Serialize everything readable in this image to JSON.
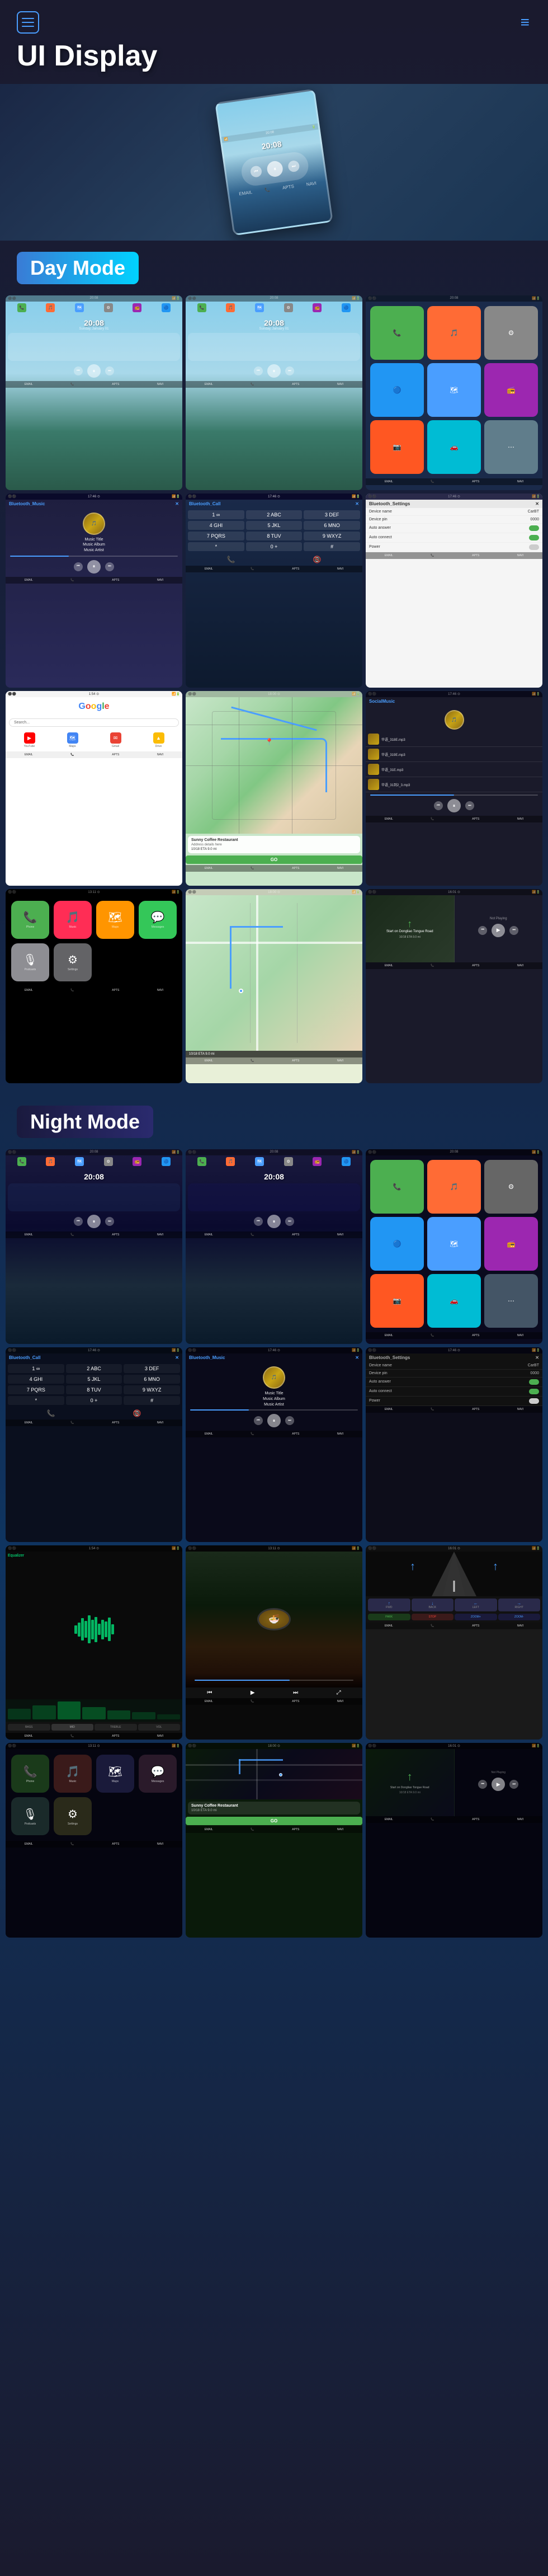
{
  "header": {
    "title": "UI Display",
    "hamburger_label": "menu",
    "menu_dots": "≡"
  },
  "day_mode": {
    "label": "Day Mode"
  },
  "night_mode": {
    "label": "Night Mode"
  },
  "screens": {
    "home1": {
      "time": "20:08",
      "subtitle": "Sunday, January 01"
    },
    "home2": {
      "time": "20:08",
      "subtitle": "Sunday, January 01"
    },
    "music": {
      "title": "Music Title",
      "album": "Music Album",
      "artist": "Music Artist",
      "bluetooth_label": "Bluetooth_Music"
    },
    "call": {
      "bluetooth_label": "Bluetooth_Call"
    },
    "settings": {
      "title": "Bluetooth_Settings",
      "device_name_label": "Device name",
      "device_name_val": "CarBT",
      "device_pin_label": "Device pin",
      "device_pin_val": "0000",
      "auto_answer_label": "Auto answer",
      "auto_connect_label": "Auto connect",
      "power_label": "Power"
    },
    "google": {
      "logo": "Google",
      "search_placeholder": "Search..."
    },
    "maps": {
      "restaurant": "Sunny Coffee Restaurant",
      "eta": "18:18 ETA",
      "distance": "10/18 ETA  9.0 mi",
      "go_label": "GO"
    },
    "social_music": {
      "title": "SocialMusic",
      "track1": "华语_318E.mp3",
      "track2": "华语_319E.mp3",
      "track3": "华语_31E.mp3",
      "track4": "华语_31到2_3.mp3"
    },
    "nav_night": {
      "start": "Start on\nDongliao\nTongue Road",
      "eta": "10/18 ETA  9.0 mi",
      "not_playing": "Not Playing"
    }
  },
  "bottom_bar": {
    "items": [
      "EMAIL",
      "PHONE",
      "APTS",
      "NAVI"
    ]
  },
  "carplay_icons": {
    "phone": "📞",
    "music": "🎵",
    "maps": "🗺️",
    "messages": "💬",
    "podcasts": "🎙️",
    "settings": "⚙️",
    "radio": "📻",
    "bt": "🔵"
  }
}
